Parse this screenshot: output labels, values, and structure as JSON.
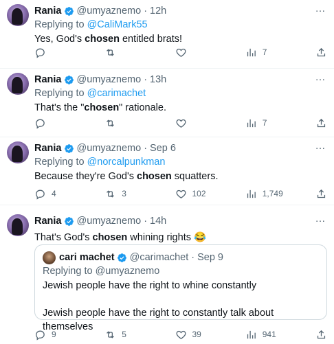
{
  "tweets": [
    {
      "name": "Rania",
      "handle": "@umyaznemo",
      "sep": "·",
      "time": "12h",
      "replying_prefix": "Replying to ",
      "replying_to": "@CaliMark55",
      "text_parts": [
        "Yes, God's ",
        "chosen",
        " entitled brats!"
      ],
      "counts": {
        "reply": "",
        "retweet": "",
        "like": "",
        "views": "7"
      }
    },
    {
      "name": "Rania",
      "handle": "@umyaznemo",
      "sep": "·",
      "time": "13h",
      "replying_prefix": "Replying to ",
      "replying_to": "@carimachet",
      "text_parts": [
        "That's the \"",
        "chosen",
        "\" rationale."
      ],
      "counts": {
        "reply": "",
        "retweet": "",
        "like": "",
        "views": "7"
      }
    },
    {
      "name": "Rania",
      "handle": "@umyaznemo",
      "sep": "·",
      "time": "Sep 6",
      "replying_prefix": "Replying to ",
      "replying_to": "@norcalpunkman",
      "text_parts": [
        "Because they're God's ",
        "chosen",
        " squatters."
      ],
      "counts": {
        "reply": "4",
        "retweet": "3",
        "like": "102",
        "views": "1,749"
      }
    },
    {
      "name": "Rania",
      "handle": "@umyaznemo",
      "sep": "·",
      "time": "14h",
      "text_parts": [
        "That's God's ",
        "chosen",
        " whining rights ",
        "😂"
      ],
      "quote": {
        "name": "cari machet",
        "handle": "@carimachet",
        "sep": "·",
        "time": "Sep 9",
        "replying": "Replying to @umyaznemo",
        "line1": "Jewish people have the right to whine constantly",
        "line2": "Jewish people have the right to constantly talk about themselves"
      },
      "counts": {
        "reply": "9",
        "retweet": "5",
        "like": "39",
        "views": "941"
      }
    }
  ],
  "icons": {
    "more": "···"
  },
  "colors": {
    "link": "#1d9bf0",
    "muted": "#536471",
    "verified": "#1d9bf0"
  }
}
